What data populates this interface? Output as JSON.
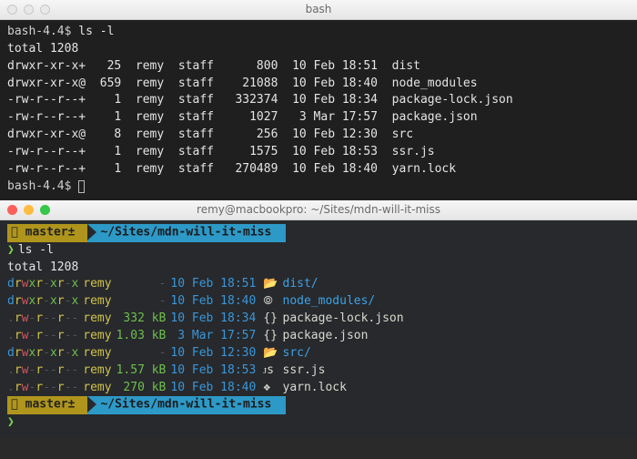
{
  "top": {
    "title": "bash",
    "prompt": "bash-4.4$",
    "command": "ls -l",
    "total": "total 1208",
    "rows": [
      {
        "perm": "drwxr-xr-x+",
        "links": "25",
        "user": "remy",
        "group": "staff",
        "size": "800",
        "date": "10 Feb 18:51",
        "name": "dist"
      },
      {
        "perm": "drwxr-xr-x@",
        "links": "659",
        "user": "remy",
        "group": "staff",
        "size": "21088",
        "date": "10 Feb 18:40",
        "name": "node_modules"
      },
      {
        "perm": "-rw-r--r--+",
        "links": "1",
        "user": "remy",
        "group": "staff",
        "size": "332374",
        "date": "10 Feb 18:34",
        "name": "package-lock.json"
      },
      {
        "perm": "-rw-r--r--+",
        "links": "1",
        "user": "remy",
        "group": "staff",
        "size": "1027",
        "date": " 3 Mar 17:57",
        "name": "package.json"
      },
      {
        "perm": "drwxr-xr-x@",
        "links": "8",
        "user": "remy",
        "group": "staff",
        "size": "256",
        "date": "10 Feb 12:30",
        "name": "src"
      },
      {
        "perm": "-rw-r--r--+",
        "links": "1",
        "user": "remy",
        "group": "staff",
        "size": "1575",
        "date": "10 Feb 18:53",
        "name": "ssr.js"
      },
      {
        "perm": "-rw-r--r--+",
        "links": "1",
        "user": "remy",
        "group": "staff",
        "size": "270489",
        "date": "10 Feb 18:40",
        "name": "yarn.lock"
      }
    ]
  },
  "bottom": {
    "title": "remy@macbookpro: ~/Sites/mdn-will-it-miss",
    "branch": " master±",
    "path": "~/Sites/mdn-will-it-miss",
    "command": "ls -l",
    "total": "total 1208",
    "rows": [
      {
        "perm": "drwxr-xr-x",
        "user": "remy",
        "size": "-",
        "date": "10 Feb 18:51",
        "icon": "folder-open",
        "name": "dist/",
        "dir": true
      },
      {
        "perm": "drwxr-xr-x",
        "user": "remy",
        "size": "-",
        "date": "10 Feb 18:40",
        "icon": "gear",
        "name": "node_modules/",
        "dir": true
      },
      {
        "perm": ".rw-r--r--",
        "user": "remy",
        "size": " 332 kB",
        "date": "10 Feb 18:34",
        "icon": "braces",
        "name": "package-lock.json",
        "dir": false
      },
      {
        "perm": ".rw-r--r--",
        "user": "remy",
        "size": "1.03 kB",
        "date": " 3 Mar 17:57",
        "icon": "braces",
        "name": "package.json",
        "dir": false
      },
      {
        "perm": "drwxr-xr-x",
        "user": "remy",
        "size": "-",
        "date": "10 Feb 12:30",
        "icon": "folder-open",
        "name": "src/",
        "dir": true
      },
      {
        "perm": ".rw-r--r--",
        "user": "remy",
        "size": "1.57 kB",
        "date": "10 Feb 18:53",
        "icon": "js",
        "name": "ssr.js",
        "dir": false
      },
      {
        "perm": ".rw-r--r--",
        "user": "remy",
        "size": " 270 kB",
        "date": "10 Feb 18:40",
        "icon": "diamond",
        "name": "yarn.lock",
        "dir": false
      }
    ]
  }
}
